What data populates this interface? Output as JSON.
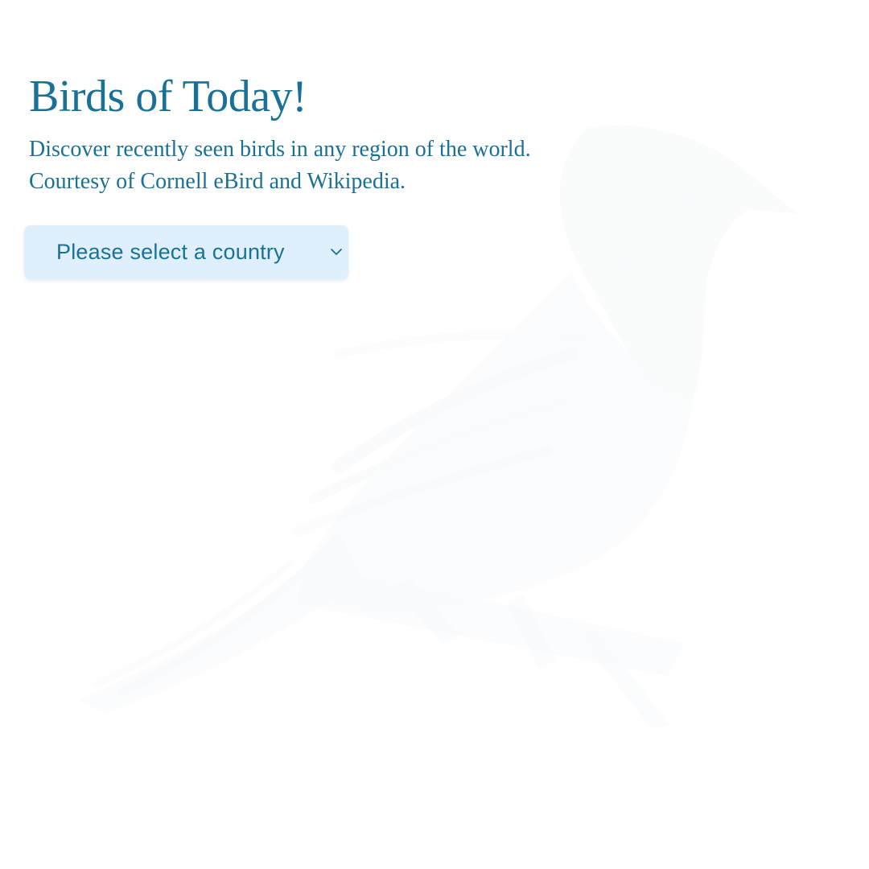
{
  "header": {
    "title": "Birds of Today!",
    "subtitle_line1": "Discover recently seen birds in any region of the world.",
    "subtitle_line2": "Courtesy of Cornell eBird and Wikipedia."
  },
  "country_select": {
    "placeholder": "Please select a country",
    "icon": "chevron-down-icon"
  },
  "background": {
    "illustration": "bird-illustration"
  },
  "colors": {
    "accent": "#1a7196",
    "select_bg": "#dff0fc",
    "illustration": "#e7eef3",
    "page_bg": "#ffffff"
  }
}
